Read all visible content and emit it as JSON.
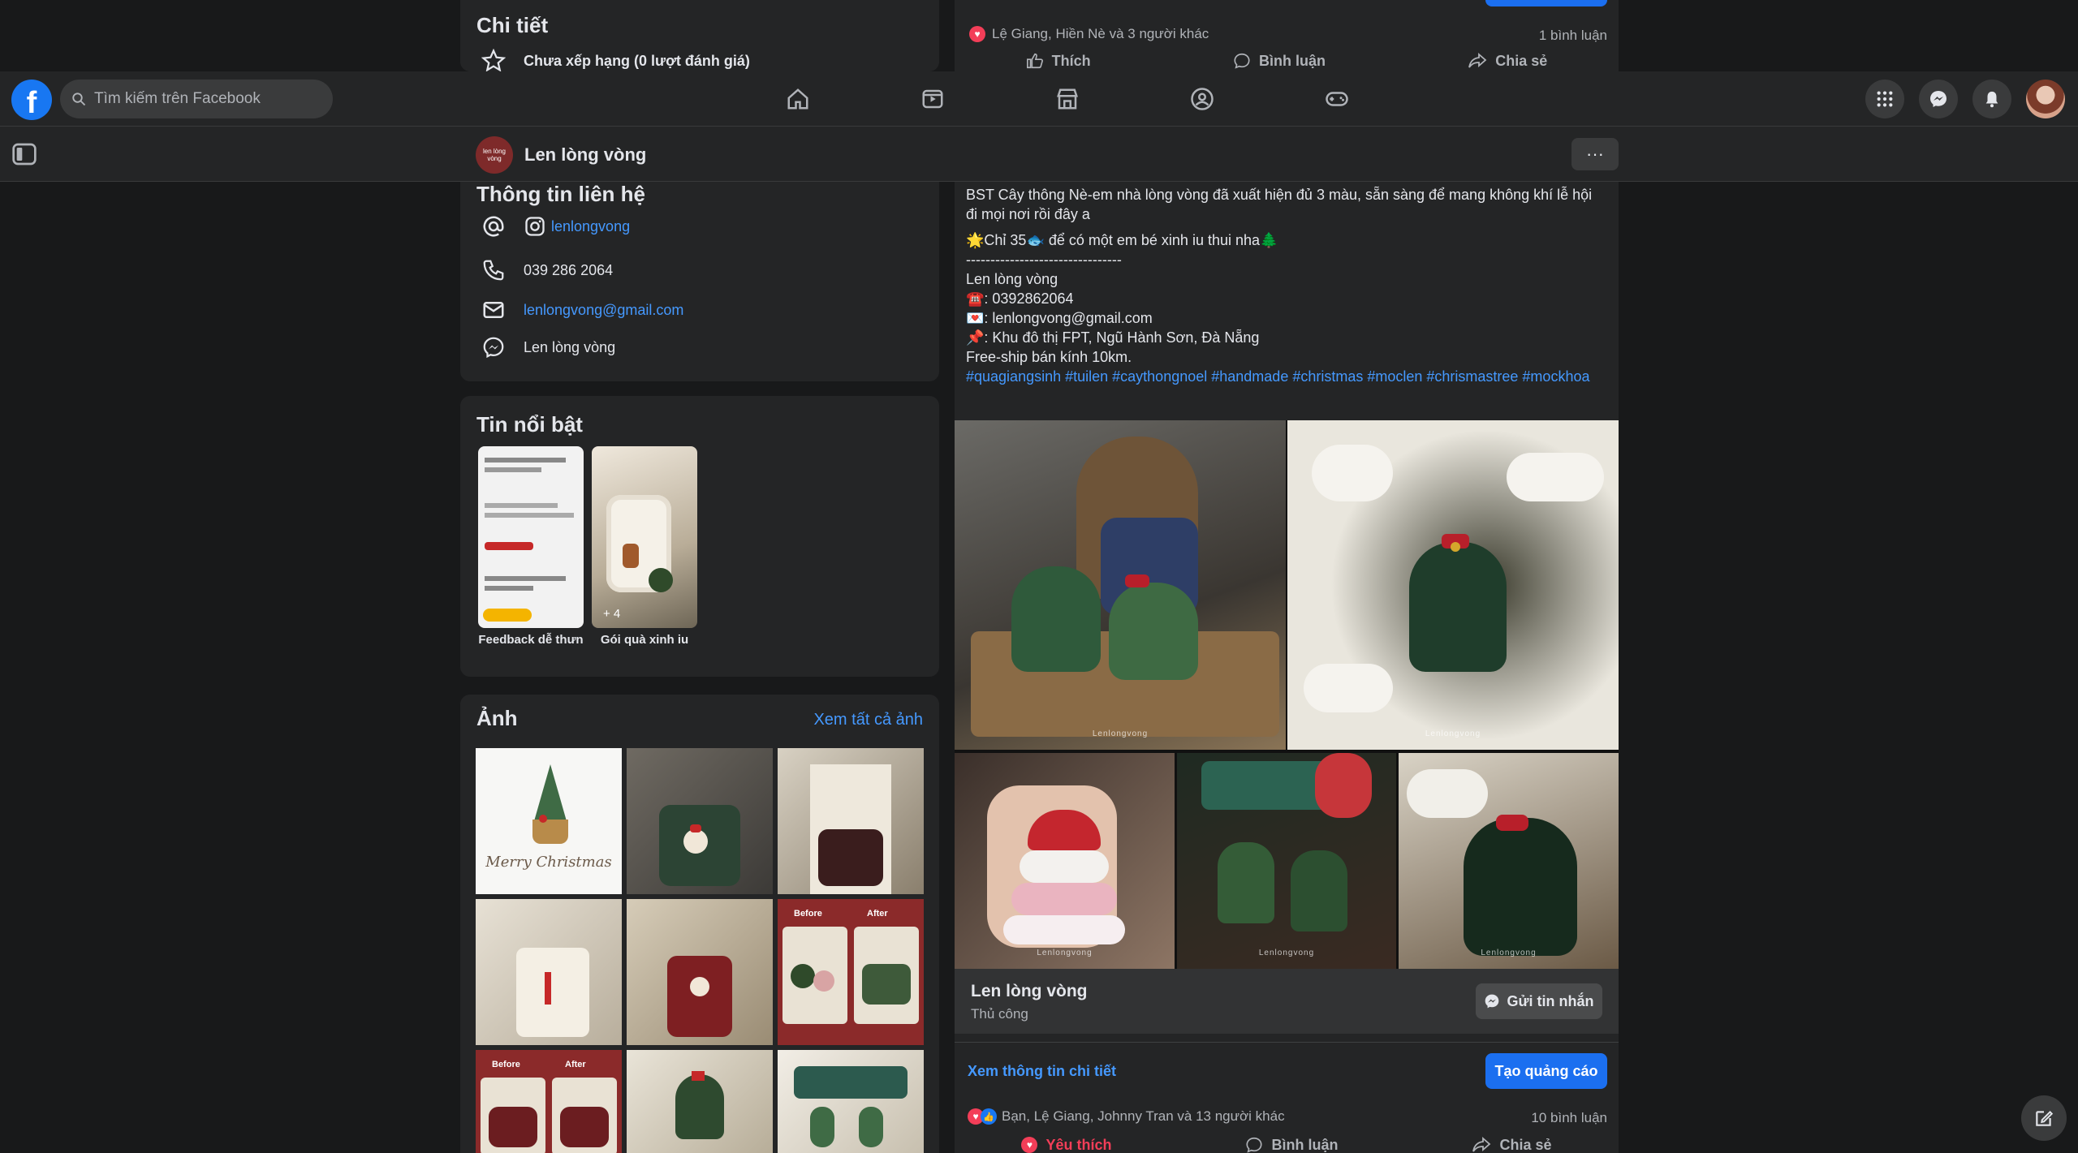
{
  "nav": {
    "search_placeholder": "Tìm kiếm trên Facebook",
    "logo_letter": "f",
    "brand_color": "#1877f2"
  },
  "subbar": {
    "page_name": "Len lòng vòng",
    "avatar_text": "len lòng vòng",
    "more_label": "···"
  },
  "details": {
    "title": "Chi tiết",
    "rating_text": "Chưa xếp hạng (0 lượt đánh giá)"
  },
  "contact": {
    "title": "Thông tin liên hệ",
    "instagram": "lenlongvong",
    "phone": "039 286 2064",
    "email": "lenlongvong@gmail.com",
    "messenger": "Len lòng vòng"
  },
  "highlights": {
    "title": "Tin nổi bật",
    "items": [
      {
        "label": "Feedback dễ thưn",
        "count": ""
      },
      {
        "label": "Gói quà xinh iu",
        "count": "+ 4"
      }
    ]
  },
  "photos": {
    "title": "Ảnh",
    "see_all": "Xem tất cả ảnh",
    "tile_texts": {
      "merry": "Merry Christmas",
      "before": "Before",
      "after": "After"
    }
  },
  "post_prev": {
    "reactions_text": "Lệ Giang, Hiền Nè và 3 người khác",
    "comments": "1 bình luận",
    "like": "Thích",
    "comment": "Bình luận",
    "share": "Chia sẻ"
  },
  "post": {
    "line1": "BST Cây thông Nè-em nhà lòng vòng đã xuất hiện đủ 3 màu, sẵn sàng để mang không khí lễ hội đi mọi nơi rồi đây a",
    "line2": "🌟Chỉ 35🐟 để có một em bé xinh iu thui nha🌲",
    "divider": "--------------------------------",
    "shop": "Len lòng vòng",
    "phone": "☎️: 0392862064",
    "email": "💌: lenlongvong@gmail.com",
    "address": "📌: Khu đô thị FPT, Ngũ Hành Sơn, Đà Nẵng",
    "ship": "Free-ship bán kính 10km.",
    "tags": "#quagiangsinh #tuilen #caythongnoel #handmade #christmas #moclen #chrismastree #mockhoa",
    "watermark": "Lenlongvong",
    "page_name": "Len lòng vòng",
    "category": "Thủ công",
    "message_btn": "Gửi tin nhắn",
    "details_link": "Xem thông tin chi tiết",
    "ad_btn": "Tạo quảng cáo",
    "reactions_text": "Bạn, Lệ Giang, Johnny Tran và 13 người khác",
    "comments": "10 bình luận",
    "love": "Yêu thích",
    "comment": "Bình luận",
    "share": "Chia sẻ"
  }
}
